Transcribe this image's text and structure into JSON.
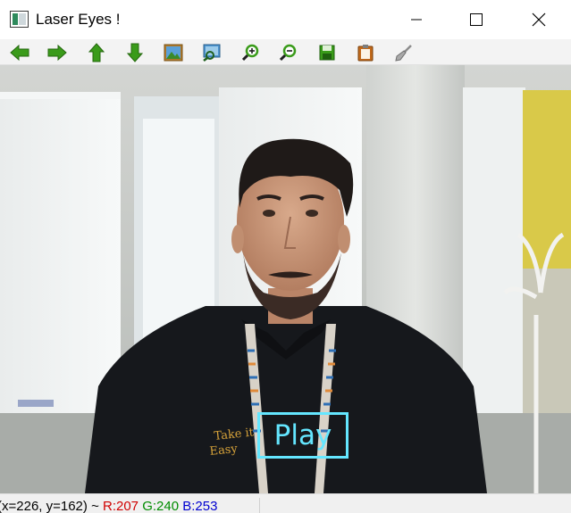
{
  "window": {
    "title": "Laser Eyes !"
  },
  "title_controls": {
    "minimize_icon": "minimize-icon",
    "maximize_icon": "maximize-icon",
    "close_icon": "close-icon"
  },
  "toolbar": {
    "buttons": [
      {
        "icon": "arrow-left-icon"
      },
      {
        "icon": "arrow-right-icon"
      },
      {
        "icon": "arrow-up-icon"
      },
      {
        "icon": "arrow-down-icon"
      },
      {
        "icon": "image-icon"
      },
      {
        "icon": "zoom-window-icon"
      },
      {
        "icon": "zoom-in-icon"
      },
      {
        "icon": "zoom-out-icon"
      },
      {
        "icon": "save-icon"
      },
      {
        "icon": "clipboard-icon"
      },
      {
        "icon": "properties-brush-icon"
      }
    ]
  },
  "overlay": {
    "play_label": "Play",
    "play_color": "#64e6ff"
  },
  "status": {
    "coords": "(x=226, y=162) ~",
    "r": "R:207",
    "g": "G:240",
    "b": "B:253"
  },
  "colors": {
    "toolbar_green": "#3a9b1a",
    "status_red": "#d00000",
    "status_green": "#008c00",
    "status_blue": "#0000d0"
  }
}
